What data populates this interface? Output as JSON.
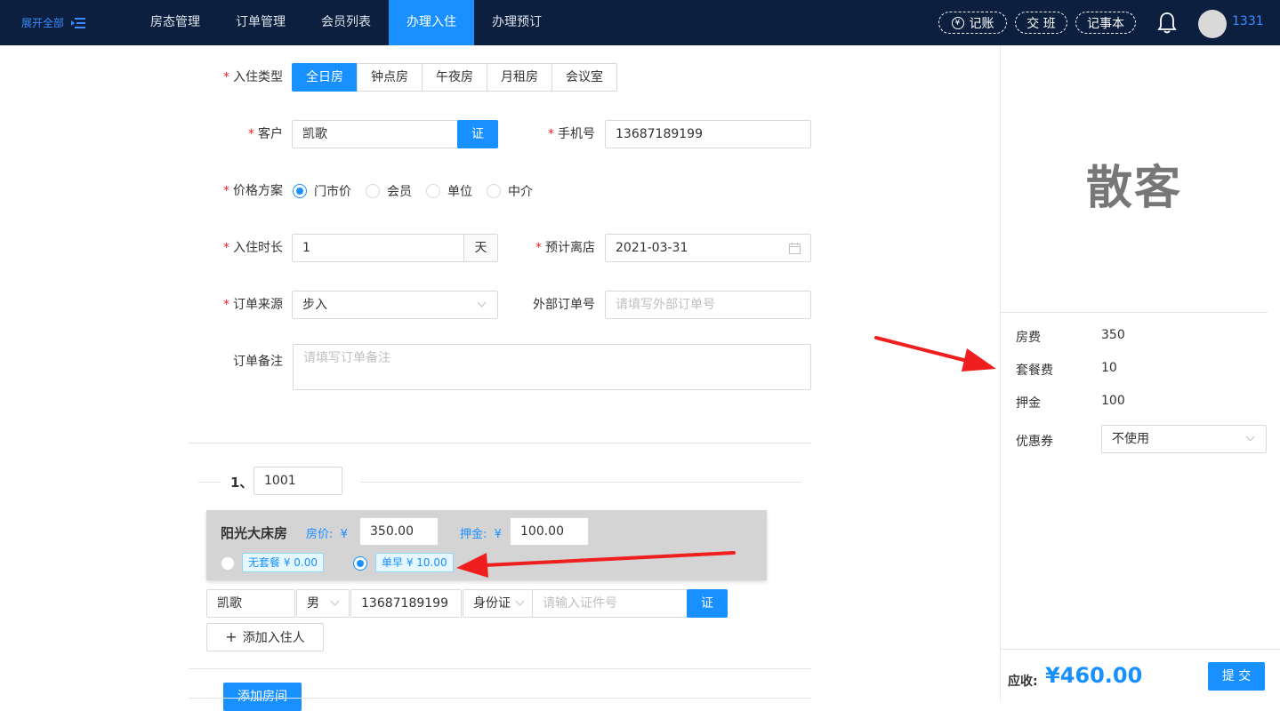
{
  "topbar": {
    "expand_label": "展开全部",
    "nav": [
      "房态管理",
      "订单管理",
      "会员列表",
      "办理入住",
      "办理预订"
    ],
    "active_nav": "办理入住",
    "actions": {
      "bookkeeping": "记账",
      "handover": "交 班",
      "notepad": "记事本"
    },
    "user": "1331"
  },
  "form": {
    "checkin_type": {
      "label": "入住类型",
      "options": [
        "全日房",
        "钟点房",
        "午夜房",
        "月租房",
        "会议室"
      ],
      "selected": "全日房"
    },
    "customer": {
      "label": "客户",
      "value": "凯歌",
      "id_button": "证"
    },
    "phone": {
      "label": "手机号",
      "value": "13687189199"
    },
    "price_plan": {
      "label": "价格方案",
      "options": [
        "门市价",
        "会员",
        "单位",
        "中介"
      ],
      "selected": "门市价"
    },
    "duration": {
      "label": "入住时长",
      "value": "1",
      "unit": "天"
    },
    "checkout": {
      "label": "预计离店",
      "value": "2021-03-31"
    },
    "source": {
      "label": "订单来源",
      "value": "步入"
    },
    "external_order": {
      "label": "外部订单号",
      "placeholder": "请填写外部订单号"
    },
    "remark": {
      "label": "订单备注",
      "placeholder": "请填写订单备注"
    }
  },
  "room": {
    "index": "1、",
    "number": "1001",
    "type": "阳光大床房",
    "price_label": "房价:",
    "currency": "¥",
    "price": "350.00",
    "deposit_label": "押金:",
    "deposit": "100.00",
    "packages": [
      {
        "label": "无套餐 ¥ 0.00",
        "selected": false
      },
      {
        "label": "单早 ¥ 10.00",
        "selected": true
      }
    ],
    "guest": {
      "name": "凯歌",
      "gender": "男",
      "phone": "13687189199",
      "id_type": "身份证",
      "id_placeholder": "请输入证件号",
      "id_button": "证"
    },
    "add_guest": "添加入住人"
  },
  "add_room": "添加房间",
  "summary": {
    "guest_type": "散客",
    "rows": [
      {
        "label": "房费",
        "value": "350"
      },
      {
        "label": "套餐费",
        "value": "10"
      },
      {
        "label": "押金",
        "value": "100"
      }
    ],
    "coupon": {
      "label": "优惠券",
      "value": "不使用"
    },
    "due_label": "应收:",
    "due_value": "¥460.00",
    "submit": "提 交"
  },
  "colors": {
    "brand": "#1890ff",
    "topbar": "#0c1f3f",
    "arrow": "#f01f1f"
  }
}
